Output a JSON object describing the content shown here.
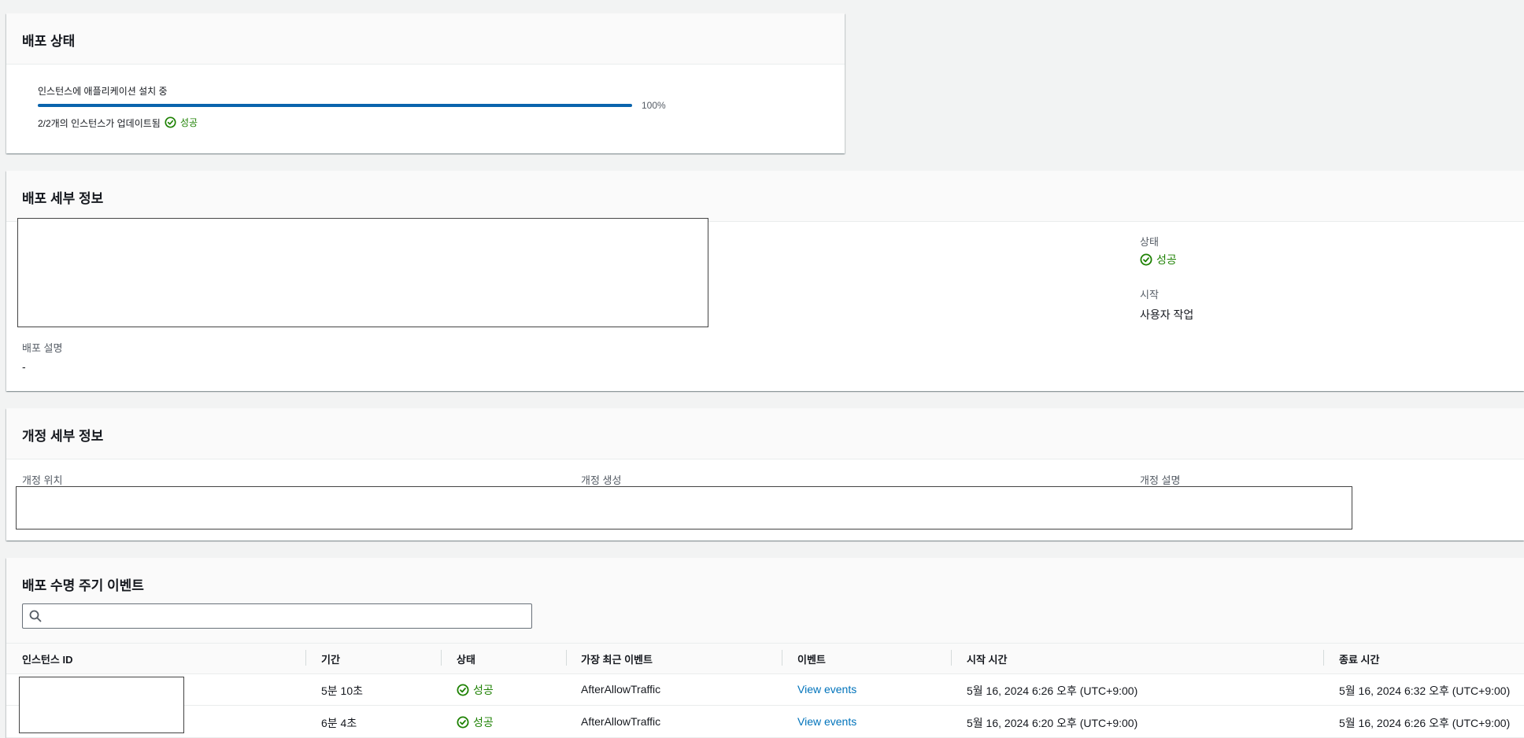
{
  "deploy_status": {
    "title": "배포 상태",
    "progress_label": "인스턴스에 애플리케이션 설치 중",
    "progress_value": 100,
    "progress_text": "100%",
    "instances_updated": "2/2개의 인스턴스가 업데이트됨",
    "status": "성공"
  },
  "deploy_details": {
    "title": "배포 세부 정보",
    "status_label": "상태",
    "status_value": "성공",
    "start_label": "시작",
    "start_value": "사용자 작업",
    "description_label": "배포 설명",
    "description_value": "-"
  },
  "revision_details": {
    "title": "개정 세부 정보",
    "location_label": "개정 위치",
    "created_label": "개정 생성",
    "description_label": "개정 설명"
  },
  "lifecycle_events": {
    "title": "배포 수명 주기 이벤트",
    "search_placeholder": "",
    "columns": [
      "인스턴스 ID",
      "기간",
      "상태",
      "가장 최근 이벤트",
      "이벤트",
      "시작 시간",
      "종료 시간"
    ],
    "rows": [
      {
        "duration": "5분 10초",
        "status": "성공",
        "latest_event": "AfterAllowTraffic",
        "events_link": "View events",
        "start_time": "5월 16, 2024 6:26 오후 (UTC+9:00)",
        "end_time": "5월 16, 2024 6:32 오후 (UTC+9:00)"
      },
      {
        "duration": "6분 4초",
        "status": "성공",
        "latest_event": "AfterAllowTraffic",
        "events_link": "View events",
        "start_time": "5월 16, 2024 6:20 오후 (UTC+9:00)",
        "end_time": "5월 16, 2024 6:26 오후 (UTC+9:00)"
      }
    ]
  },
  "colors": {
    "success": "#1d8102",
    "link": "#0073bb",
    "progress": "#0a64ad",
    "background": "#f2f3f3"
  },
  "icons": {
    "success": "status-success-icon",
    "search": "search-icon"
  }
}
